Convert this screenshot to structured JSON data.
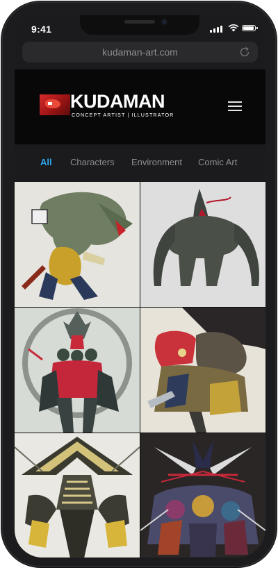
{
  "status_bar": {
    "time": "9:41",
    "icons": [
      "signal-icon",
      "wifi-icon",
      "battery-icon"
    ]
  },
  "browser": {
    "url": "kudaman-art.com",
    "reload_icon": "reload-icon"
  },
  "site": {
    "brand": "KUDAMAN",
    "tagline": "CONCEPT ARTIST  |  ILLUSTRATOR",
    "menu_icon": "hamburger-menu-icon"
  },
  "filters": {
    "active_color": "#2ea6ea",
    "items": [
      {
        "label": "All",
        "active": true
      },
      {
        "label": "Characters",
        "active": false
      },
      {
        "label": "Environment",
        "active": false
      },
      {
        "label": "Comic Art",
        "active": false
      }
    ]
  },
  "gallery": {
    "items": [
      "green-creature-character-art",
      "dark-horned-beast-character-art",
      "red-demon-samurai-character-art",
      "red-armored-group-illustration",
      "striped-pyramid-warrior-character-art",
      "horned-army-comic-illustration"
    ]
  }
}
